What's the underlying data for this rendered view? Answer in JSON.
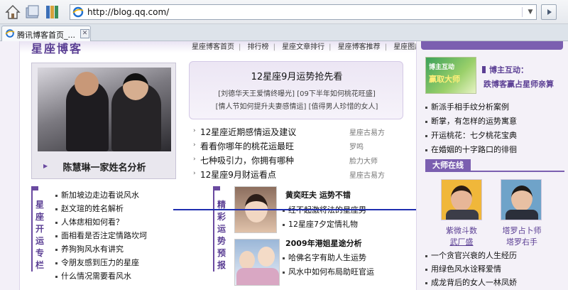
{
  "browser": {
    "address": "http://blog.qq.com/",
    "tab_title": "腾讯博客首页_...",
    "icons": [
      "home-icon",
      "favorites-icon",
      "books-icon",
      "ie-icon",
      "dropdown-icon",
      "go-icon",
      "close-icon"
    ]
  },
  "header": {
    "logo": "星座博客",
    "nav": [
      "星座博客首页",
      "排行榜",
      "星座文章排行",
      "星座博客推荐",
      "星座图库"
    ]
  },
  "feature": {
    "caption": "陈慧琳一家姓名分析"
  },
  "promo": {
    "title": "12星座9月运势抢先看",
    "line1": "[刘德华天王爱情终曝光] [09下半年如何桃花旺盛]",
    "line2": "[情人节如何提升夫妻感情运] [值得男人珍惜的女人]"
  },
  "mid_list": [
    {
      "text": "12星座近期感情运及建议",
      "source": "星座古易方"
    },
    {
      "text": "看看你哪年的桃花运最旺",
      "source": "罗鸣"
    },
    {
      "text": "七种吸引力，你拥有哪种",
      "source": "脸力大师"
    },
    {
      "text": "12星座9月财运看点",
      "source": "星座古易方"
    }
  ],
  "fengshui": {
    "title_chars": [
      "星",
      "座",
      "开",
      "运",
      "专",
      "栏"
    ],
    "items": [
      "新加坡边走边看说风水",
      "赵文瑄的姓名解析",
      "人体痣相如何看？",
      "面相看是否注定情路坎坷",
      "养狗狗风水有讲究",
      "令朋友感到压力的星座",
      "什么情况需要看风水"
    ]
  },
  "fortune": {
    "title_chars": [
      "精",
      "彩",
      "运",
      "势",
      "预",
      "报"
    ],
    "headline1": "黄奕旺夫  运势不错",
    "items1": [
      "经不起激将法的星座男",
      "12星座7夕定情礼物"
    ],
    "headline2": "2009年港姐星途分析",
    "items2": [
      "哈佛名字有助人生运势",
      "风水中如何布局助旺官运"
    ]
  },
  "right": {
    "banner_top": "博主互动",
    "banner_main": "赢取大师",
    "highlight1": "博主互动：",
    "highlight2": "跌博客赢占星师亲算",
    "links": [
      "新派手相手纹分析案例",
      "断掌，有怎样的运势寓意",
      "开运桃花：七夕桃花宝典",
      "在婚姻的十字路口的徘徊"
    ],
    "section": "大师在线",
    "masters": [
      {
        "line1": "紫微斗数",
        "line2": "武厂盛"
      },
      {
        "line1": "塔罗占卜师",
        "line2": "塔罗右手"
      }
    ],
    "links2": [
      "一个贪官兴衰的人生经历",
      "用绿色风水诠释爱情",
      "成龙背后的女人一林凤娇"
    ]
  }
}
